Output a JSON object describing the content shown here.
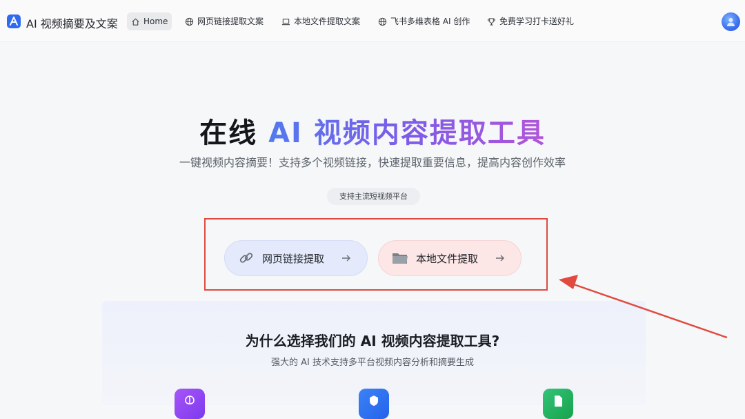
{
  "app": {
    "title": "AI 视频摘要及文案"
  },
  "nav": {
    "items": [
      {
        "label": "Home",
        "icon": "home-icon"
      },
      {
        "label": "网页链接提取文案",
        "icon": "globe-icon"
      },
      {
        "label": "本地文件提取文案",
        "icon": "laptop-icon"
      },
      {
        "label": "飞书多维表格 AI 创作",
        "icon": "globe-icon"
      },
      {
        "label": "免费学习打卡送好礼",
        "icon": "trophy-icon"
      }
    ]
  },
  "hero": {
    "title_plain": "在线",
    "title_gradient": " AI 视频内容提取工具",
    "subtitle": "一键视频内容摘要！支持多个视频链接，快速提取重要信息，提高内容创作效率",
    "platform_pill": "支持主流短视频平台"
  },
  "actions": {
    "web_extract": "网页链接提取",
    "local_extract": "本地文件提取"
  },
  "why": {
    "title": "为什么选择我们的 AI 视频内容提取工具?",
    "subtitle": "强大的 AI 技术支持多平台视频内容分析和摘要生成"
  },
  "colors": {
    "accent_blue": "#4f7cf0",
    "accent_purple": "#b055d8",
    "annotation_red": "#e04a40"
  }
}
